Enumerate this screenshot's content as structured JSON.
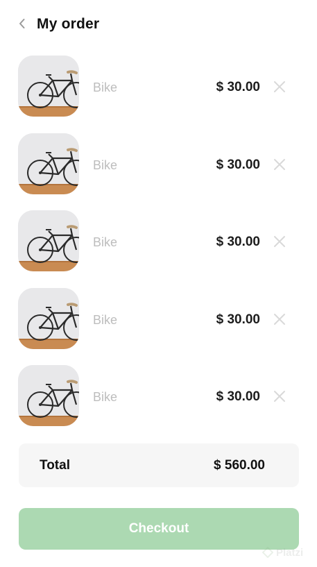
{
  "header": {
    "title": "My order",
    "back_icon": "chevron-left-icon"
  },
  "order": {
    "items": [
      {
        "name": "Bike",
        "price": "$ 30.00",
        "image": "bicycle-photo",
        "remove_icon": "close-icon"
      },
      {
        "name": "Bike",
        "price": "$ 30.00",
        "image": "bicycle-photo",
        "remove_icon": "close-icon"
      },
      {
        "name": "Bike",
        "price": "$ 30.00",
        "image": "bicycle-photo",
        "remove_icon": "close-icon"
      },
      {
        "name": "Bike",
        "price": "$ 30.00",
        "image": "bicycle-photo",
        "remove_icon": "close-icon"
      },
      {
        "name": "Bike",
        "price": "$ 30.00",
        "image": "bicycle-photo",
        "remove_icon": "close-icon"
      }
    ]
  },
  "summary": {
    "total_label": "Total",
    "total_value": "$ 560.00"
  },
  "checkout": {
    "label": "Checkout"
  },
  "watermark": {
    "text": "Platzi"
  },
  "colors": {
    "checkout_bg": "#acd9b2",
    "total_bg": "#f6f6f6",
    "muted_text": "#bdbdbd",
    "primary_text": "#111111"
  }
}
